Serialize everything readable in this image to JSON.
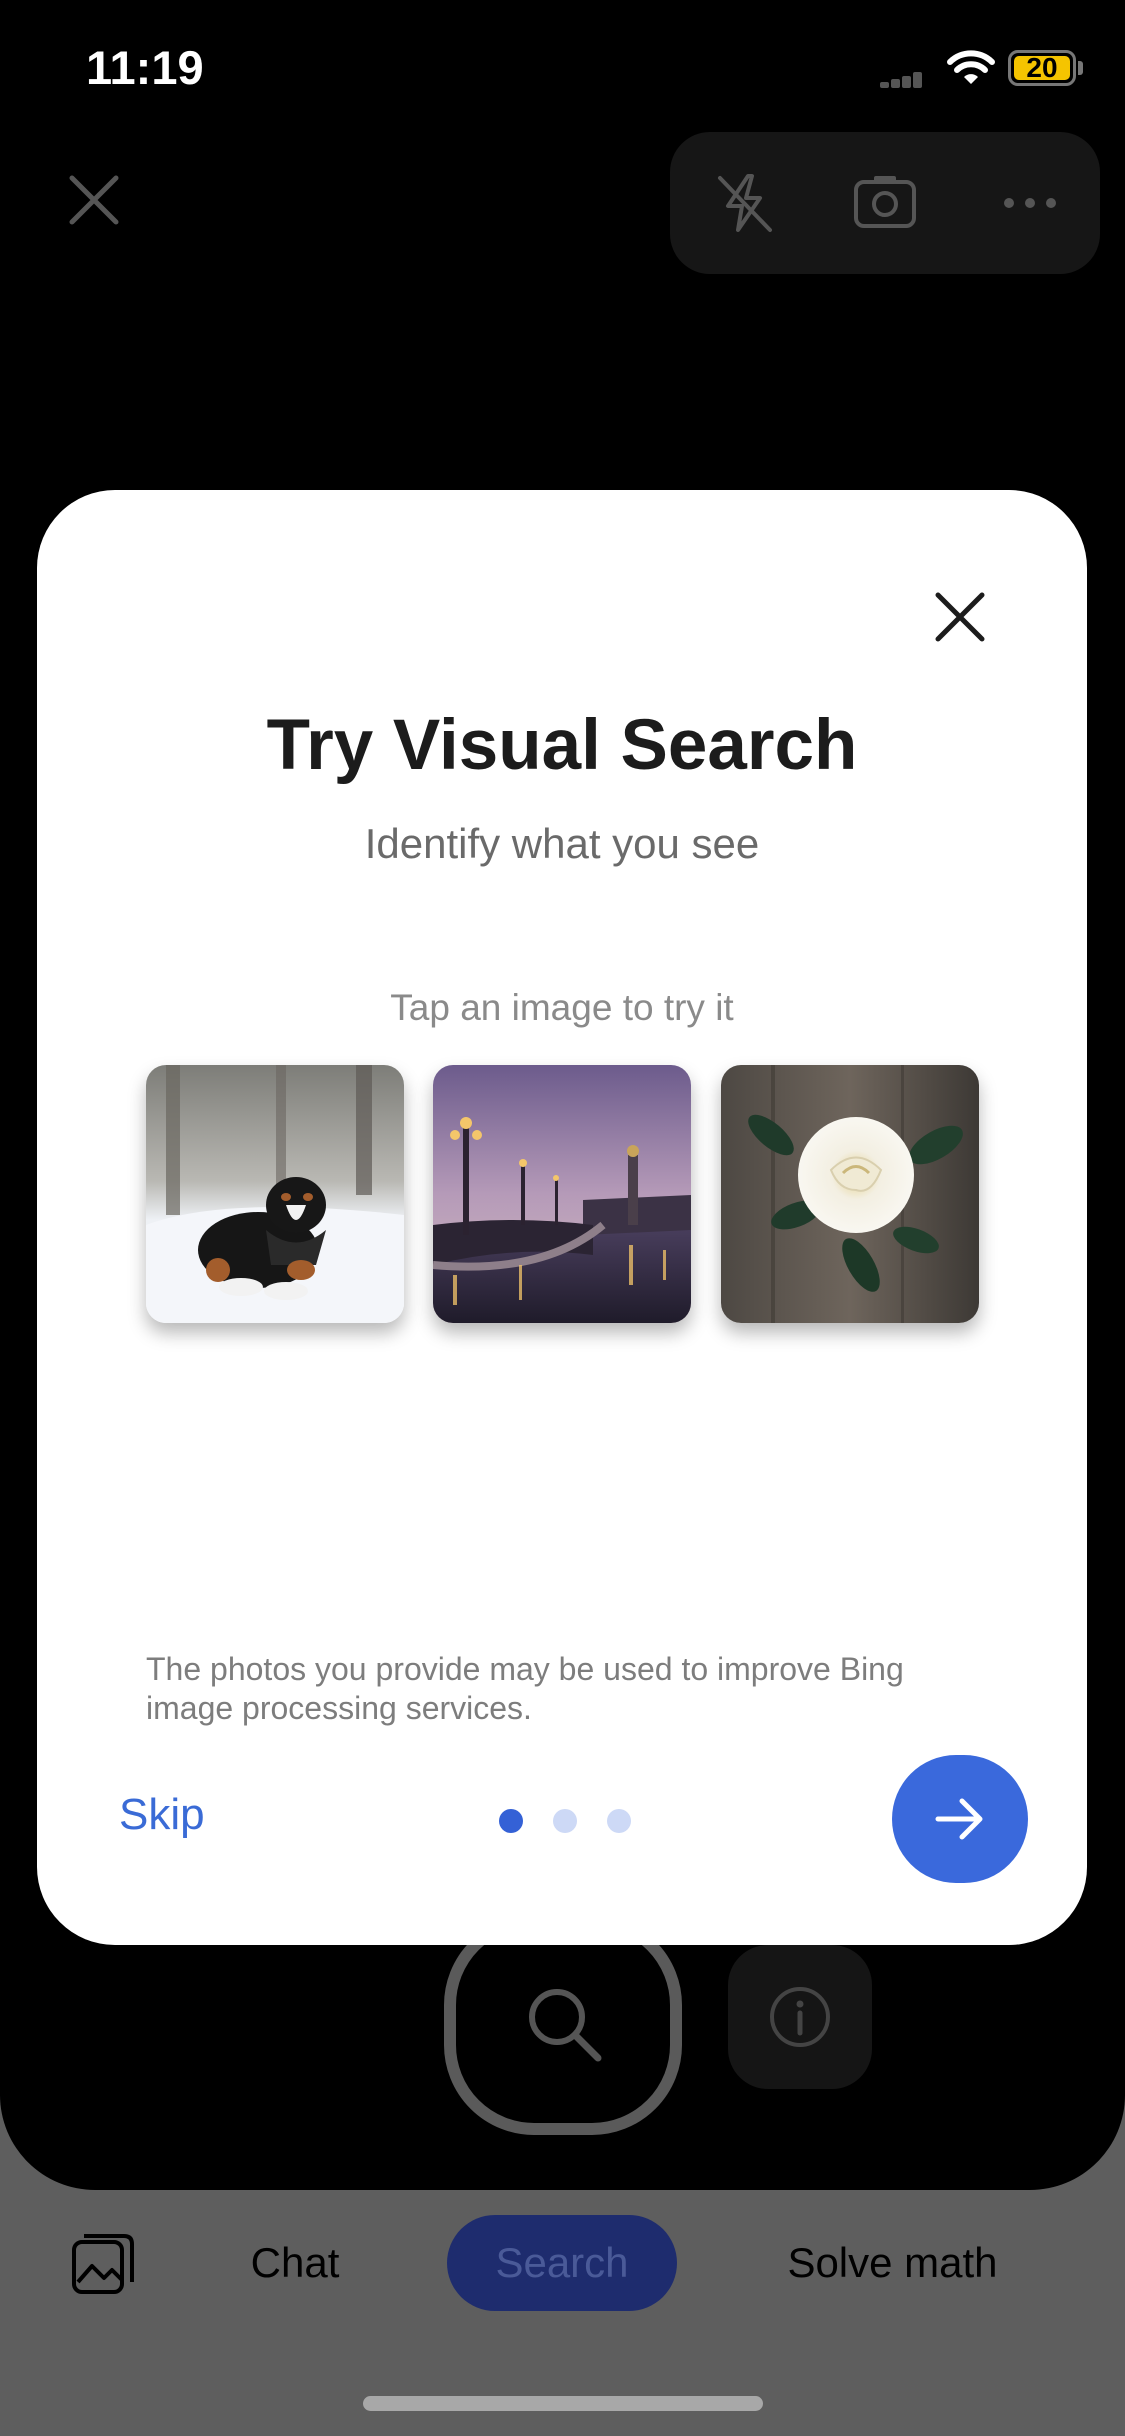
{
  "status_bar": {
    "time": "11:19",
    "battery": "20",
    "signal_icon": "cellular-signal-icon",
    "wifi_icon": "wifi-icon",
    "battery_color": "#f5c400"
  },
  "camera_toolbar": {
    "icons": [
      "close-icon",
      "flash-off-icon",
      "switch-camera-icon",
      "more-icon"
    ]
  },
  "modal": {
    "title": "Try Visual Search",
    "subtitle": "Identify what you see",
    "tap_hint": "Tap an image to try it",
    "samples": [
      {
        "name": "dog-in-snow-image"
      },
      {
        "name": "bridge-at-dusk-image"
      },
      {
        "name": "white-rose-image"
      }
    ],
    "disclaimer": "The photos you provide may be used to improve Bing image processing services.",
    "skip_label": "Skip",
    "page_count": 3,
    "active_page": 1,
    "accent_color": "#3a69dc"
  },
  "tabs": {
    "items": [
      {
        "label": "Chat"
      },
      {
        "label": "Search"
      },
      {
        "label": "Solve math"
      }
    ],
    "active": "Search"
  }
}
